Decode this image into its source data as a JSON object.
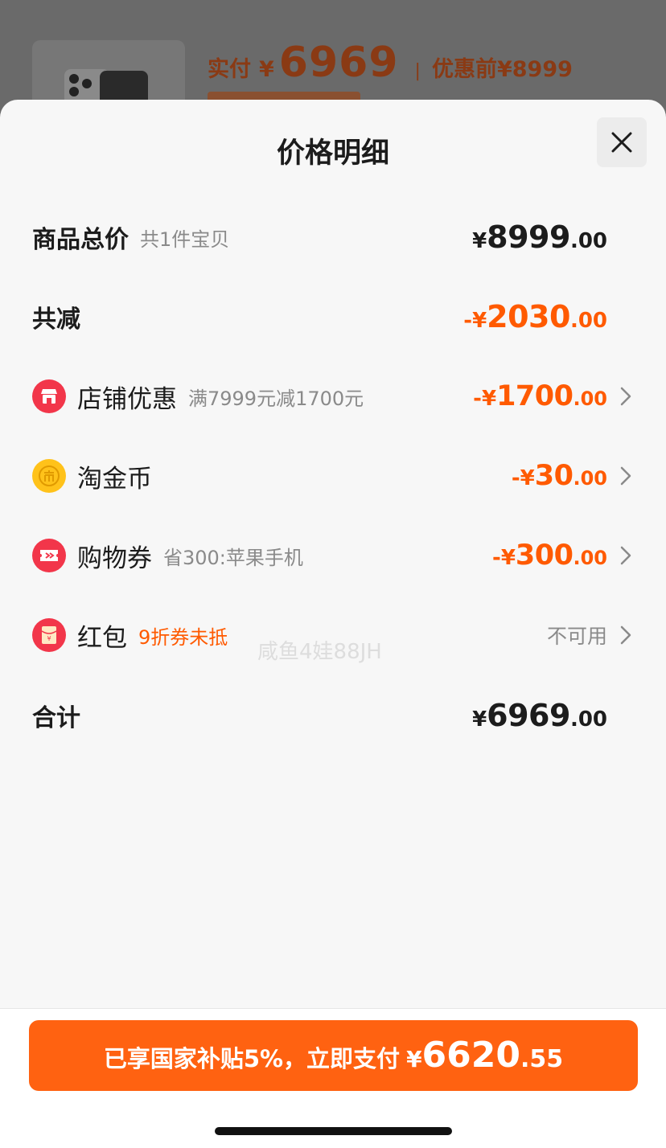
{
  "background": {
    "paid_label": "实付",
    "currency": "¥",
    "paid_amount": "6969",
    "separator": "|",
    "before_label": "优惠前",
    "before_amount": "¥8999"
  },
  "sheet": {
    "title": "价格明细",
    "close_icon": "close-icon"
  },
  "rows": {
    "total": {
      "label": "商品总价",
      "sub": "共1件宝贝",
      "prefix": "¥",
      "integer": "8999",
      "decimal": ".00"
    },
    "reduced": {
      "label": "共减",
      "prefix": "-¥",
      "integer": "2030",
      "decimal": ".00"
    },
    "store": {
      "icon": "store-icon",
      "label": "店铺优惠",
      "sub": "满7999元减1700元",
      "prefix": "-¥",
      "integer": "1700",
      "decimal": ".00"
    },
    "coins": {
      "icon": "coin-icon",
      "label": "淘金币",
      "prefix": "-¥",
      "integer": "30",
      "decimal": ".00"
    },
    "voucher": {
      "icon": "ticket-icon",
      "label": "购物券",
      "sub": "省300:苹果手机",
      "prefix": "-¥",
      "integer": "300",
      "decimal": ".00"
    },
    "redpacket": {
      "icon": "red-packet-icon",
      "label": "红包",
      "sub": "9折券未抵",
      "status": "不可用"
    },
    "sum": {
      "label": "合计",
      "prefix": "¥",
      "integer": "6969",
      "decimal": ".00"
    }
  },
  "watermark": "咸鱼4娃88JH",
  "footer": {
    "pay_text": "已享国家补贴5%，立即支付",
    "currency": "¥",
    "pay_integer": "6620",
    "pay_decimal": ".55"
  },
  "colors": {
    "accent": "#ff5a00",
    "button": "#ff6211",
    "icon_red": "#f2364a",
    "icon_gold": "#ffc21a"
  }
}
